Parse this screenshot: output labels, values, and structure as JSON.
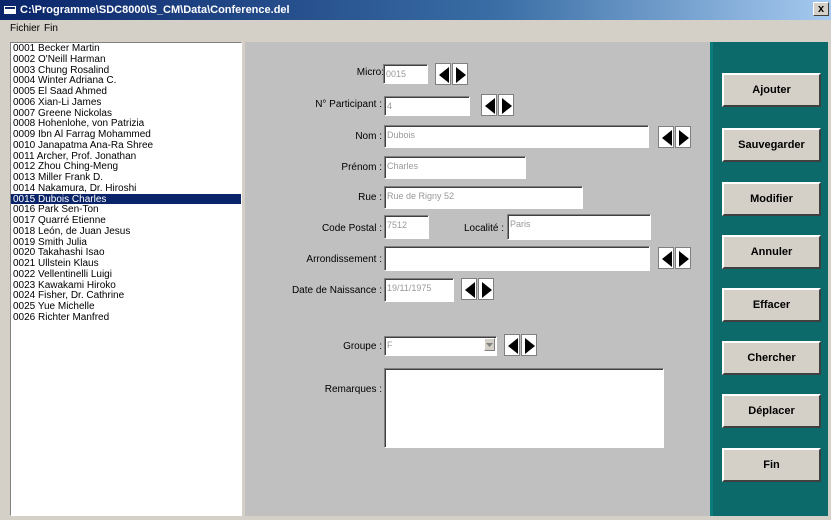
{
  "window": {
    "title": "C:\\Programme\\SDC8000\\S_CM\\Data\\Conference.del",
    "close_label": "x"
  },
  "menu": {
    "items": [
      "Fichier",
      "Fin"
    ]
  },
  "participants": {
    "selected_index": 14,
    "items": [
      "0001 Becker Martin",
      "0002 O'Neill Harman",
      "0003 Chung Rosalind",
      "0004 Winter Adriana C.",
      "0005 El Saad Ahmed",
      "0006 Xian-Li James",
      "0007 Greene Nickolas",
      "0008 Hohenlohe, von Patrizia",
      "0009 Ibn Al Farrag Mohammed",
      "0010 Janapatma Ana-Ra Shree",
      "0011 Archer, Prof. Jonathan",
      "0012 Zhou Ching-Meng",
      "0013 Miller Frank D.",
      "0014 Nakamura, Dr. Hiroshi",
      "0015 Dubois Charles",
      "0016 Park Sen-Ton",
      "0017 Quarré Etienne",
      "0018 León, de Juan Jesus",
      "0019 Smith Julia",
      "0020 Takahashi Isao",
      "0021 Ullstein Klaus",
      "0022 Vellentinelli Luigi",
      "0023 Kawakami Hiroko",
      "0024 Fisher, Dr. Cathrine",
      "0025 Yue Michelle",
      "0026 Richter Manfred"
    ]
  },
  "form": {
    "micro": {
      "label": "Micro:",
      "value": "0015"
    },
    "participant": {
      "label": "N° Participant :",
      "value": "4"
    },
    "nom": {
      "label": "Nom :",
      "value": "Dubois"
    },
    "prenom": {
      "label": "Prénom :",
      "value": "Charles"
    },
    "rue": {
      "label": "Rue :",
      "value": "Rue de Rigny 52"
    },
    "code_postal": {
      "label": "Code Postal :",
      "value": "7512"
    },
    "localite": {
      "label": "Localité :",
      "value": "Paris"
    },
    "arrondissement": {
      "label": "Arrondissement :",
      "value": ""
    },
    "date_naissance": {
      "label": "Date de Naissance :",
      "value": "19/11/1975"
    },
    "groupe": {
      "label": "Groupe :",
      "value": "F"
    },
    "remarques": {
      "label": "Remarques :",
      "value": ""
    }
  },
  "buttons": [
    "Ajouter",
    "Sauvegarder",
    "Modifier",
    "Annuler",
    "Effacer",
    "Chercher",
    "Déplacer",
    "Fin"
  ],
  "colors": {
    "titlebar_start": "#0a246a",
    "titlebar_end": "#a6caf0",
    "selection": "#0a246a",
    "button_panel": "#0c6a6a",
    "form_bg": "#c0c0c0"
  }
}
